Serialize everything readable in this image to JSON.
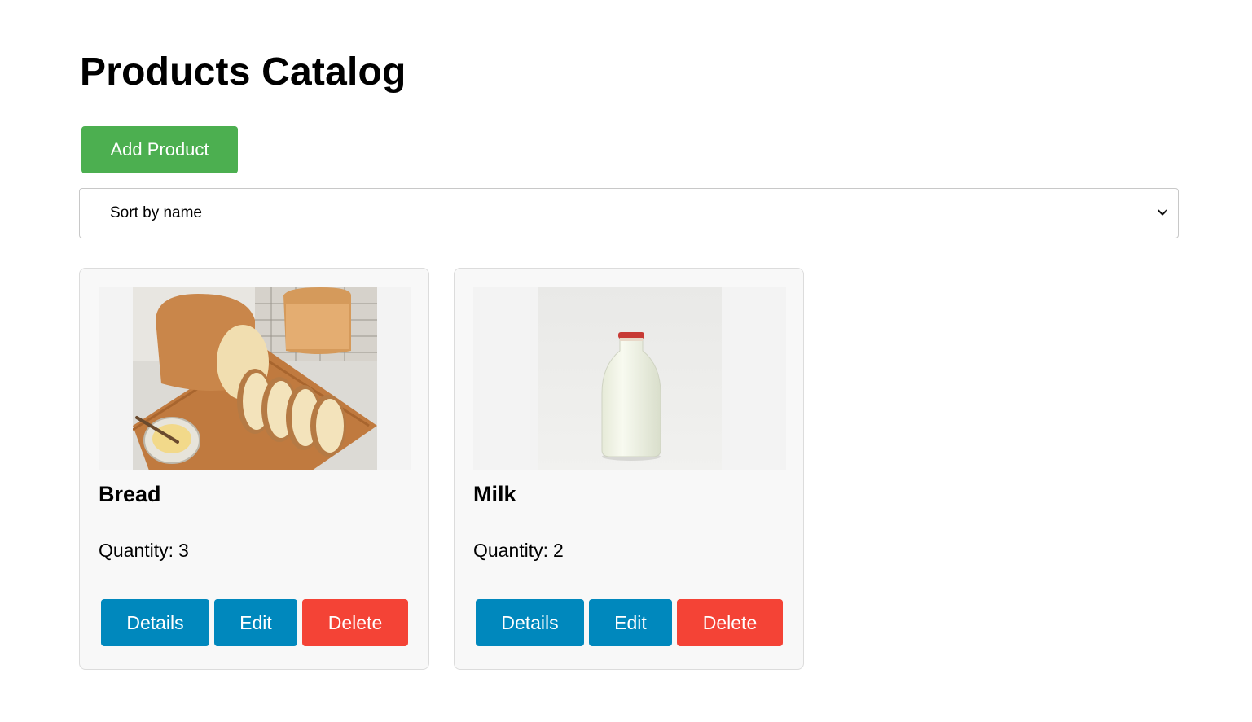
{
  "page": {
    "title": "Products Catalog"
  },
  "toolbar": {
    "add_label": "Add Product"
  },
  "sort": {
    "selected": "Sort by name"
  },
  "products": [
    {
      "name": "Bread",
      "quantity_label": "Quantity:",
      "quantity": "3",
      "details_label": "Details",
      "edit_label": "Edit",
      "delete_label": "Delete"
    },
    {
      "name": "Milk",
      "quantity_label": "Quantity:",
      "quantity": "2",
      "details_label": "Details",
      "edit_label": "Edit",
      "delete_label": "Delete"
    }
  ],
  "colors": {
    "add": "#4caf50",
    "primary": "#0088bd",
    "danger": "#f44336"
  }
}
